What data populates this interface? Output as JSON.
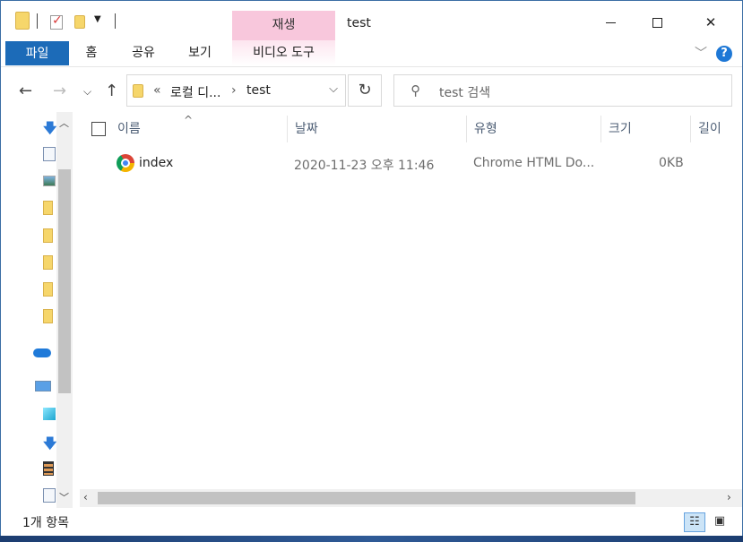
{
  "window": {
    "title": "test",
    "context_tab_group": "재생"
  },
  "ribbon": {
    "tabs": [
      "파일",
      "홈",
      "공유",
      "보기",
      "비디오 도구"
    ]
  },
  "address": {
    "overflow_label": "«",
    "crumb_parent": "로컬 디...",
    "crumb_current": "test"
  },
  "search": {
    "placeholder": "test 검색"
  },
  "columns": [
    "이름",
    "날짜",
    "유형",
    "크기",
    "길이"
  ],
  "files": [
    {
      "name": "index",
      "date": "2020-11-23 오후 11:46",
      "type": "Chrome HTML Do...",
      "size": "0KB",
      "icon": "chrome-icon"
    }
  ],
  "status": {
    "item_count": "1개 항목"
  },
  "colors": {
    "file_tab": "#1c6bb8",
    "context_tab": "#f8c7dc",
    "help": "#1e78d6"
  }
}
